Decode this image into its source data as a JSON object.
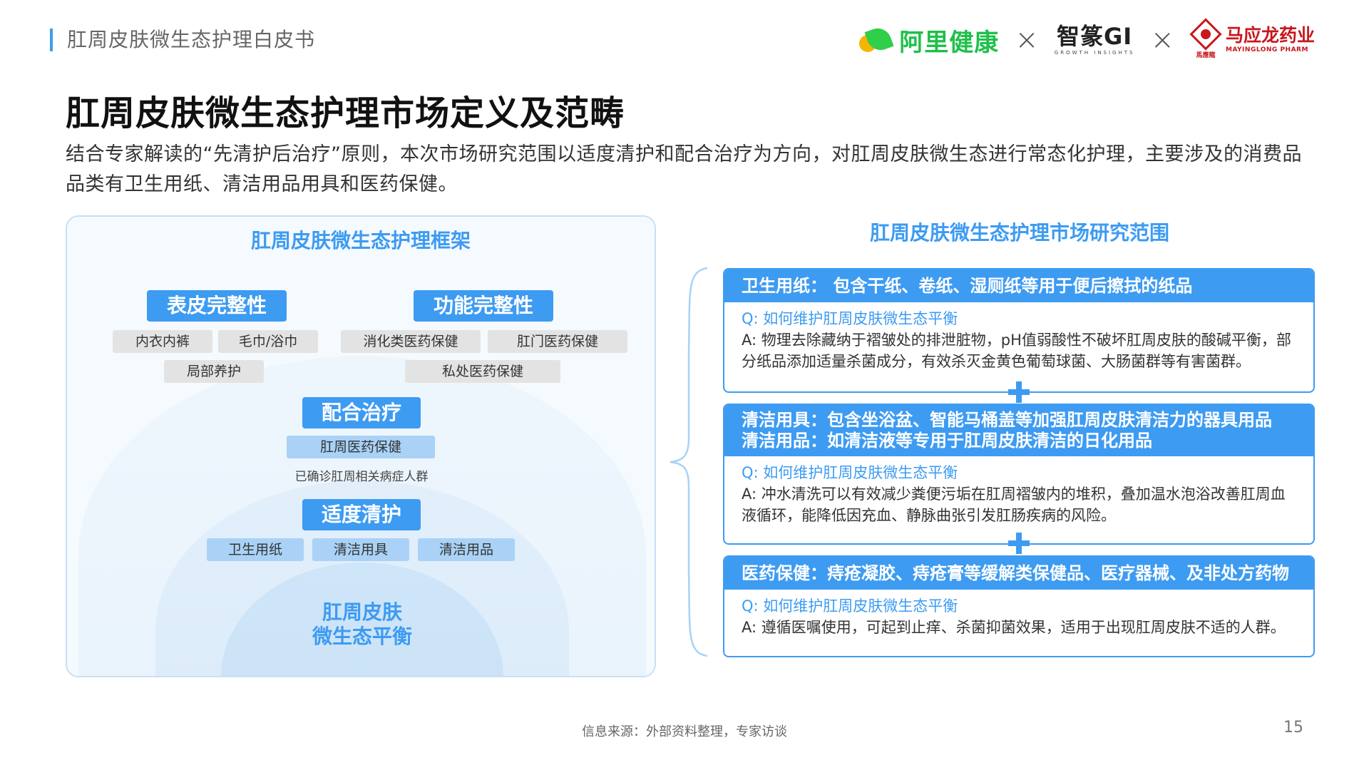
{
  "header": {
    "doc_title": "肛周皮肤微生态护理白皮书",
    "logos": {
      "alihealth": "阿里健康",
      "zhizhuan": "智篆GI",
      "zhizhuan_sub": "GROWTH INSIGHTS",
      "mayinglong_cn": "马应龙药业",
      "mayinglong_en": "MAYINGLONG PHARM",
      "separator": "×"
    }
  },
  "page_title": "肛周皮肤微生态护理市场定义及范畴",
  "intro": "结合专家解读的“先清护后治疗”原则，本次市场研究范围以适度清护和配合治疗为方向，对肛周皮肤微生态进行常态化护理，主要涉及的消费品品类有卫生用纸、清洁用品用具和医药保健。",
  "framework": {
    "title": "肛周皮肤微生态护理框架",
    "epidermis": {
      "label": "表皮完整性",
      "chips": [
        "内衣内裤",
        "毛巾/浴巾",
        "局部养护"
      ]
    },
    "function": {
      "label": "功能完整性",
      "chips": [
        "消化类医药保健",
        "肛门医药保健",
        "私处医药保健"
      ]
    },
    "treatment": {
      "label": "配合治疗",
      "chip": "肛周医药保健",
      "note": "已确诊肛周相关病症人群"
    },
    "cleaning": {
      "label": "适度清护",
      "chips": [
        "卫生用纸",
        "清洁用具",
        "清洁用品"
      ]
    },
    "core_line1": "肛周皮肤",
    "core_line2": "微生态平衡"
  },
  "scope": {
    "title": "肛周皮肤微生态护理市场研究范围",
    "cards": [
      {
        "heading": "卫生用纸：  包含干纸、卷纸、湿厕纸等用于便后擦拭的纸品",
        "q": "Q:  如何维护肛周皮肤微生态平衡",
        "a": "A:  物理去除藏纳于褶皱处的排泄脏物，pH值弱酸性不破坏肛周皮肤的酸碱平衡，部分纸品添加适量杀菌成分，有效杀灭金黄色葡萄球菌、大肠菌群等有害菌群。"
      },
      {
        "heading": "清洁用具：包含坐浴盆、智能马桶盖等加强肛周皮肤清洁力的器具用品",
        "heading2": "清洁用品：如清洁液等专用于肛周皮肤清洁的日化用品",
        "q": "Q:  如何维护肛周皮肤微生态平衡",
        "a": "A:  冲水清洗可以有效减少粪便污垢在肛周褶皱内的堆积，叠加温水泡浴改善肛周血液循环，能降低因充血、静脉曲张引发肛肠疾病的风险。"
      },
      {
        "heading": "医药保健：痔疮凝胶、痔疮膏等缓解类保健品、医疗器械、及非处方药物",
        "q": "Q:  如何维护肛周皮肤微生态平衡",
        "a": "A:  遵循医嘱使用，可起到止痒、杀菌抑菌效果，适用于出现肛周皮肤不适的人群。"
      }
    ]
  },
  "footer": {
    "source": "信息来源：外部资料整理，专家访谈",
    "page_number": "15"
  },
  "colors": {
    "accent": "#3d9bf2",
    "chip_gray": "#e3e3e3",
    "chip_blue": "#a9d2f6",
    "brand_red": "#c8171d",
    "brand_green": "#1fc04b"
  }
}
